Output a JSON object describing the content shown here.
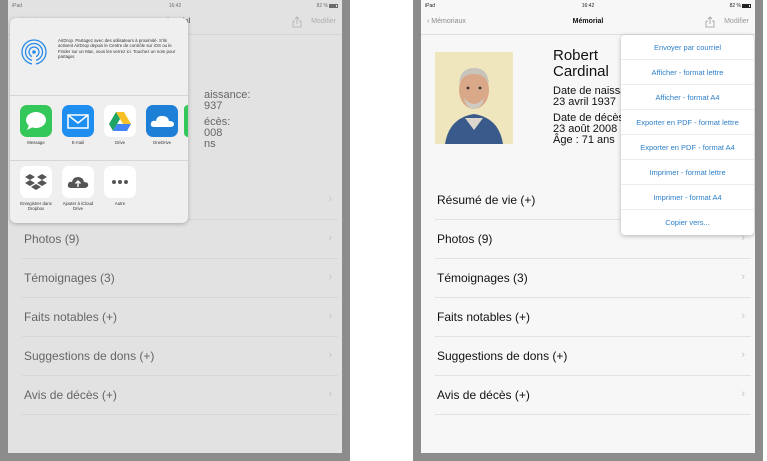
{
  "status_bar": {
    "device": "iPad",
    "time": "16:42",
    "battery": "82 %"
  },
  "nav": {
    "back_label": "Mémoriaux",
    "title": "Mémorial",
    "edit_label": "Modifier"
  },
  "person": {
    "first_name": "Robert",
    "last_name": "Cardinal",
    "birth_label": "Date de naissance:",
    "birth_date": "23 avril 1937",
    "death_label": "Date de décès:",
    "death_date": "23 août 2008",
    "age": "Âge : 71 ans"
  },
  "left_person_fragments": {
    "last_name": "al",
    "birth_label": "aissance:",
    "birth_date": "937",
    "death_label": "écès:",
    "death_date": "008",
    "age": "ns"
  },
  "list_items": [
    {
      "label": "Résumé de vie (+)"
    },
    {
      "label": "Photos (9)"
    },
    {
      "label": "Témoignages (3)"
    },
    {
      "label": "Faits notables (+)"
    },
    {
      "label": "Suggestions de dons (+)"
    },
    {
      "label": "Avis de décès (+)"
    }
  ],
  "share_sheet": {
    "airdrop_text": "AirDrop. Partagez avec des utilisateurs à proximité. S'ils activent AirDrop depuis le Centre de contrôle sur iOS ou le Finder sur un Mac, vous les verrez ici. Touchez un nom pour partager.",
    "apps": [
      {
        "label": "Message",
        "icon": "messages-icon",
        "color": "#34c759"
      },
      {
        "label": "E-mail",
        "icon": "mail-icon",
        "color": "#1f8ef1"
      },
      {
        "label": "Drive",
        "icon": "google-drive-icon",
        "color": "#ffffff"
      },
      {
        "label": "OneDrive",
        "icon": "onedrive-icon",
        "color": "#1e7fd6"
      }
    ],
    "actions": [
      {
        "label": "Enregistrer dans Dropbox",
        "icon": "dropbox-icon"
      },
      {
        "label": "Ajouter à iCloud Drive",
        "icon": "icloud-upload-icon"
      },
      {
        "label": "Autre",
        "icon": "more-icon"
      }
    ]
  },
  "share_menu": {
    "items": [
      "Envoyer par courriel",
      "Afficher - format lettre",
      "Afficher - format A4",
      "Exporter en PDF - format lettre",
      "Exporter en PDF - format A4",
      "Imprimer - format lettre",
      "Imprimer - format A4",
      "Copier vers..."
    ]
  },
  "colors": {
    "accent": "#2f80c9",
    "bezel": "#8c8c8c",
    "separator": "#e2e2e2"
  }
}
